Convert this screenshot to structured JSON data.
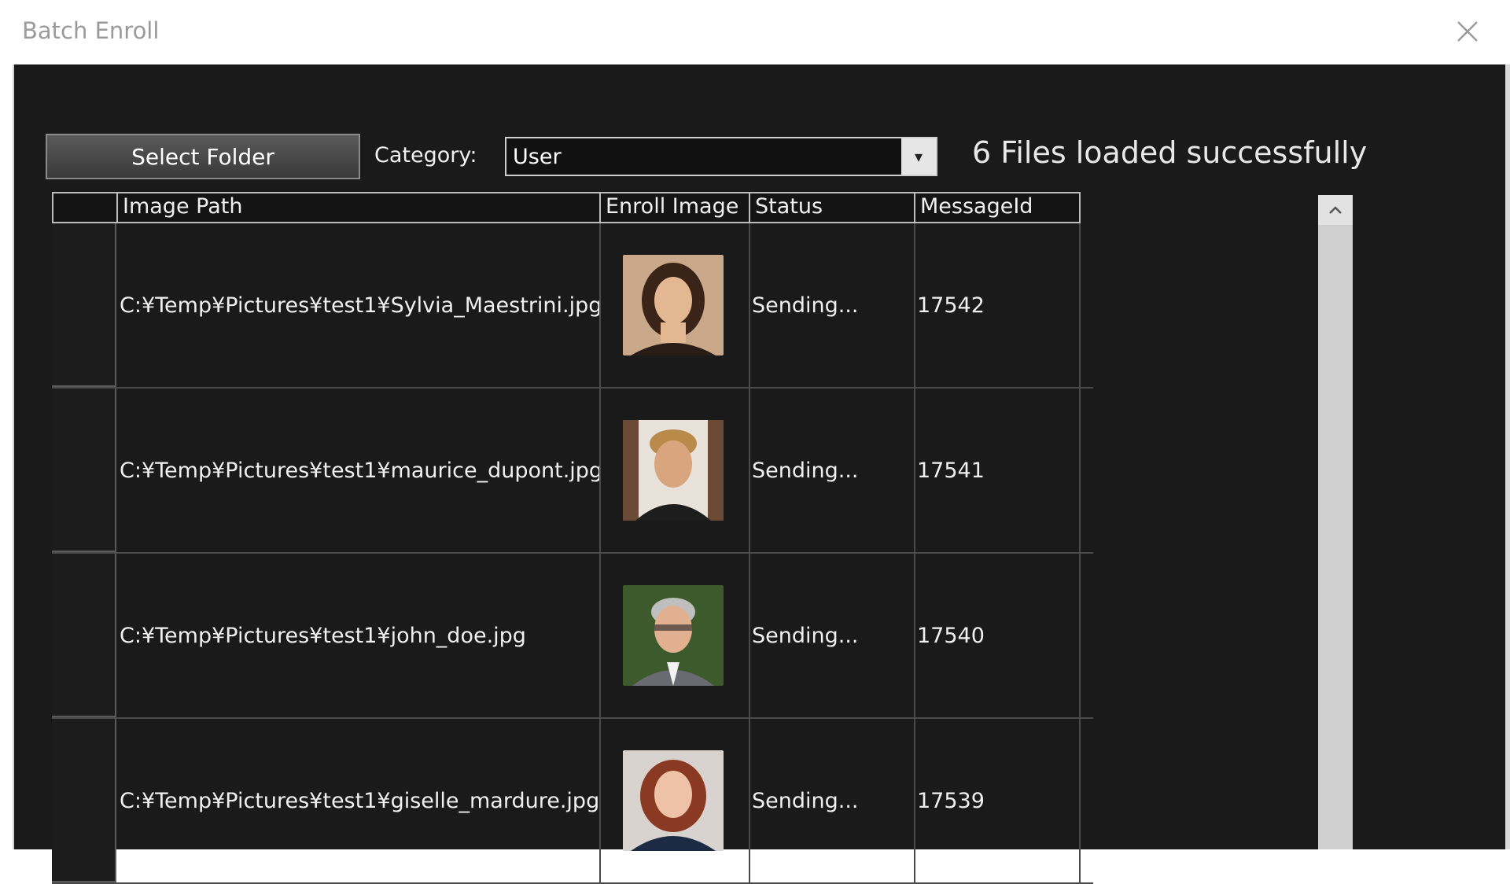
{
  "window": {
    "title": "Batch Enroll"
  },
  "toolbar": {
    "select_folder_label": "Select Folder",
    "category_label": "Category:",
    "category_value": "User",
    "status_message": "6 Files loaded successfully"
  },
  "grid": {
    "columns": [
      "Image Path",
      "Enroll Image",
      "Status",
      "MessageId"
    ],
    "rows": [
      {
        "path": "C:¥Temp¥Pictures¥test1¥Sylvia_Maestrini.jpg",
        "status": "Sending...",
        "message_id": "17542",
        "thumb_icon": "portrait-woman-dark-hair"
      },
      {
        "path": "C:¥Temp¥Pictures¥test1¥maurice_dupont.jpg",
        "status": "Sending...",
        "message_id": "17541",
        "thumb_icon": "portrait-man-blond"
      },
      {
        "path": "C:¥Temp¥Pictures¥test1¥john_doe.jpg",
        "status": "Sending...",
        "message_id": "17540",
        "thumb_icon": "portrait-man-gray-hair"
      },
      {
        "path": "C:¥Temp¥Pictures¥test1¥giselle_mardure.jpg",
        "status": "Sending...",
        "message_id": "17539",
        "thumb_icon": "portrait-woman-red-hair"
      }
    ]
  },
  "colors": {
    "background": "#1a1a1a",
    "text": "#f0f0f0",
    "scrollbar": "#cfcfcf"
  }
}
